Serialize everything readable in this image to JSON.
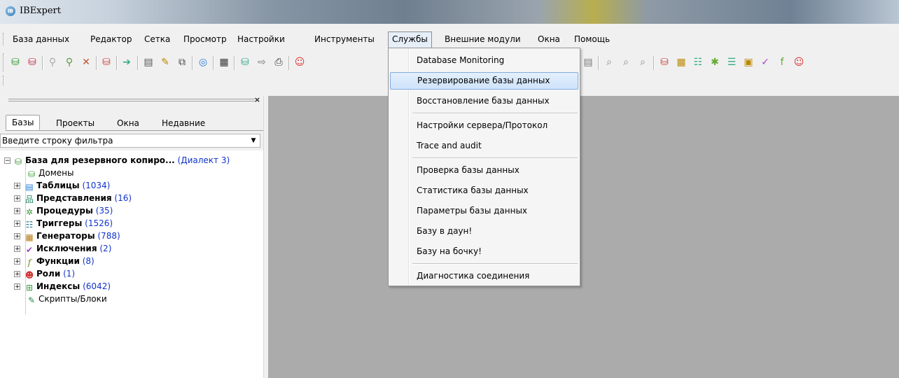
{
  "window": {
    "title": "IBExpert",
    "icon": "ibexpert-app-icon"
  },
  "menubar": {
    "items": [
      {
        "label": "База данных",
        "key": "database"
      },
      {
        "label": "Редактор",
        "key": "editor"
      },
      {
        "label": "Сетка",
        "key": "grid"
      },
      {
        "label": "Просмотр",
        "key": "view"
      },
      {
        "label": "Настройки",
        "key": "settings"
      },
      {
        "label": "Инструменты",
        "key": "tools"
      },
      {
        "label": "Службы",
        "key": "services",
        "active": true
      },
      {
        "label": "Внешние модули",
        "key": "plugins"
      },
      {
        "label": "Окна",
        "key": "windows"
      },
      {
        "label": "Помощь",
        "key": "help"
      }
    ]
  },
  "services_menu": {
    "items": [
      "Database Monitoring",
      "Резервирование базы данных",
      "Восстановление базы данных",
      "Настройки сервера/Протокол",
      "Trace and audit",
      "Проверка базы данных",
      "Статистика базы данных",
      "Параметры базы данных",
      "Базу в даун!",
      "Базу на бочку!",
      "Диагностика соединения"
    ],
    "highlighted": "Резервирование базы данных"
  },
  "left_panel": {
    "close": "×",
    "tabs": [
      "Базы",
      "Проекты",
      "Окна",
      "Недавние"
    ],
    "active_tab": "Базы",
    "filter_placeholder": "Введите строку фильтра",
    "tree": {
      "root": {
        "label": "База для резервного копиро...",
        "dialect": "(Диалект 3)"
      },
      "domains": "Домены",
      "tables": {
        "label": "Таблицы",
        "count": "(1034)"
      },
      "views": {
        "label": "Представления",
        "count": "(16)"
      },
      "procedures": {
        "label": "Процедуры",
        "count": "(35)"
      },
      "triggers": {
        "label": "Триггеры",
        "count": "(1526)"
      },
      "generators": {
        "label": "Генераторы",
        "count": "(788)"
      },
      "exceptions": {
        "label": "Исключения",
        "count": "(2)"
      },
      "functions": {
        "label": "Функции",
        "count": "(8)"
      },
      "roles": {
        "label": "Роли",
        "count": "(1)"
      },
      "indices": {
        "label": "Индексы",
        "count": "(6042)"
      },
      "scripts": "Скрипты/Блоки"
    }
  },
  "colors": {
    "mdi_background": "#ababab",
    "menu_highlight": "#cfe3fb",
    "count_blue": "#1133cc"
  }
}
